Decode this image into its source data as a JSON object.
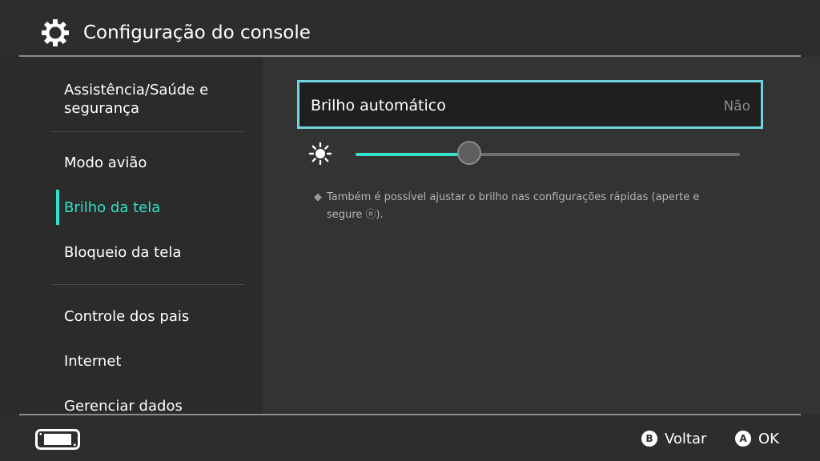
{
  "header": {
    "title": "Configuração do console",
    "icon": "gear-icon"
  },
  "sidebar": {
    "items": [
      {
        "label": "Assistência/Saúde e",
        "label2": "segurança",
        "active": false
      },
      {
        "label": "Modo avião",
        "active": false
      },
      {
        "label": "Brilho da tela",
        "active": true
      },
      {
        "label": "Bloqueio da tela",
        "active": false
      },
      {
        "label": "Controle dos pais",
        "active": false
      },
      {
        "label": "Internet",
        "active": false
      },
      {
        "label": "Gerenciar dados",
        "active": false
      }
    ]
  },
  "main": {
    "auto_brightness": {
      "label": "Brilho automático",
      "value": "Não"
    },
    "brightness_slider": {
      "value_fraction": 0.296,
      "icon": "sun-icon"
    },
    "note": "Também é possível ajustar o brilho nas configurações rápidas (aperte e segure ⓞ)."
  },
  "footer": {
    "console_icon": "console-icon",
    "back": {
      "key": "B",
      "label": "Voltar"
    },
    "ok": {
      "key": "A",
      "label": "OK"
    }
  },
  "colors": {
    "accent": "#32e1c6",
    "focus_border": "#6dd5de",
    "background": "#2d2d2d",
    "panel": "#333333"
  }
}
